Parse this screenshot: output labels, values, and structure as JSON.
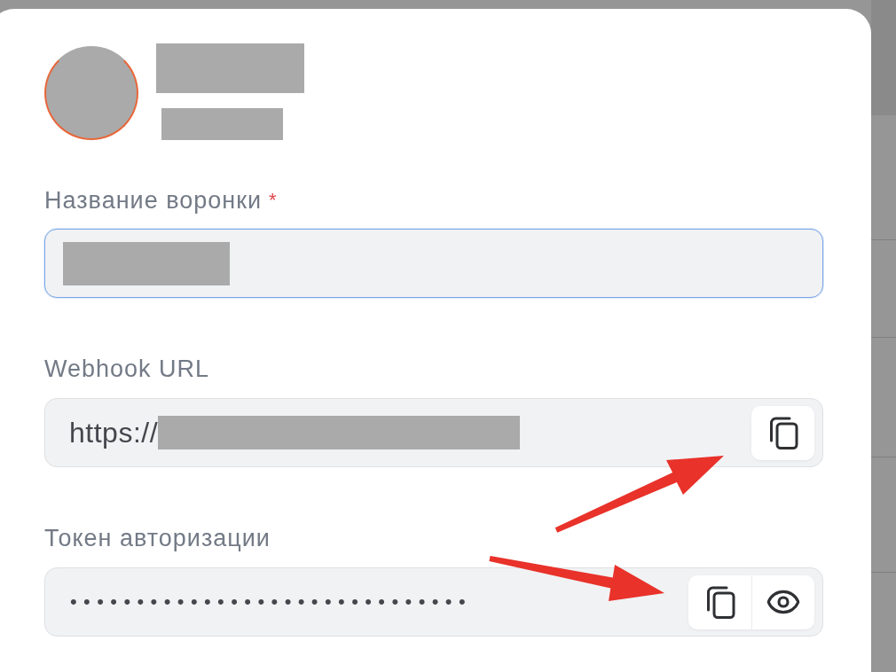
{
  "fields": [
    {
      "kind": "text",
      "label": "Название воронки",
      "required_mark": "*",
      "focused": true,
      "redacted": true
    },
    {
      "kind": "url",
      "label": "Webhook URL",
      "value": "https://",
      "focused": false,
      "redacted": true,
      "actions": [
        {
          "kind": "copy"
        }
      ]
    },
    {
      "kind": "secret",
      "label": "Токен авторизации",
      "value": "••••••••••••••••••••••••••••••",
      "focused": false,
      "redacted": false,
      "actions": [
        {
          "kind": "copy"
        },
        {
          "kind": "reveal"
        }
      ]
    }
  ]
}
